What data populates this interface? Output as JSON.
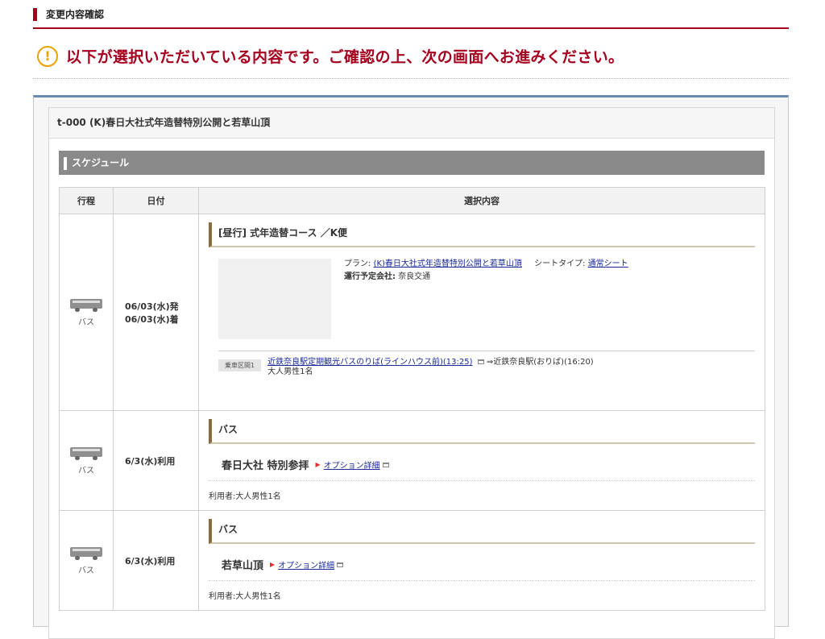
{
  "header": {
    "label": "変更内容確認"
  },
  "notice": {
    "icon": "exclamation-circle-icon",
    "text": "以下が選択いただいている内容です。ご確認の上、次の画面へお進みください。"
  },
  "tour": {
    "title": "t-000 (K)春日大社式年造替特別公開と若草山頂"
  },
  "schedule": {
    "section_label": "スケジュール",
    "columns": [
      "行程",
      "日付",
      "選択内容"
    ],
    "rows": [
      {
        "kind": "バス",
        "icon": "bus-icon",
        "dates": [
          "06/03(水)発",
          "06/03(水)着"
        ],
        "title": "[昼行] 式年造替コース ／K便",
        "plan_label": "プラン:",
        "plan_link": "(K)春日大社式年造替特別公開と若草山頂",
        "seat_label": "シートタイプ:",
        "seat_link": "通常シート",
        "operator_label": "運行予定会社:",
        "operator": "奈良交通",
        "ride_badge": "乗車区間1",
        "ride_link": "近鉄奈良駅定期観光バスのりば(ラインハウス前)(13:25)",
        "ride_to": "⇒近鉄奈良駅(おりば)(16:20)",
        "passengers": "大人男性1名"
      },
      {
        "kind": "バス",
        "icon": "bus-icon",
        "date": "6/3(水)利用",
        "title": "バス",
        "option_name": "春日大社 特別参拝",
        "option_link": "オプション詳細",
        "user": "利用者:大人男性1名"
      },
      {
        "kind": "バス",
        "icon": "bus-icon",
        "date": "6/3(水)利用",
        "title": "バス",
        "option_name": "若草山頂",
        "option_link": "オプション詳細",
        "user": "利用者:大人男性1名"
      }
    ]
  },
  "colors": {
    "accent": "#a5001e",
    "warning": "#e8a300",
    "link": "#1a2a9a",
    "section_mark": "#8a6a3e"
  }
}
